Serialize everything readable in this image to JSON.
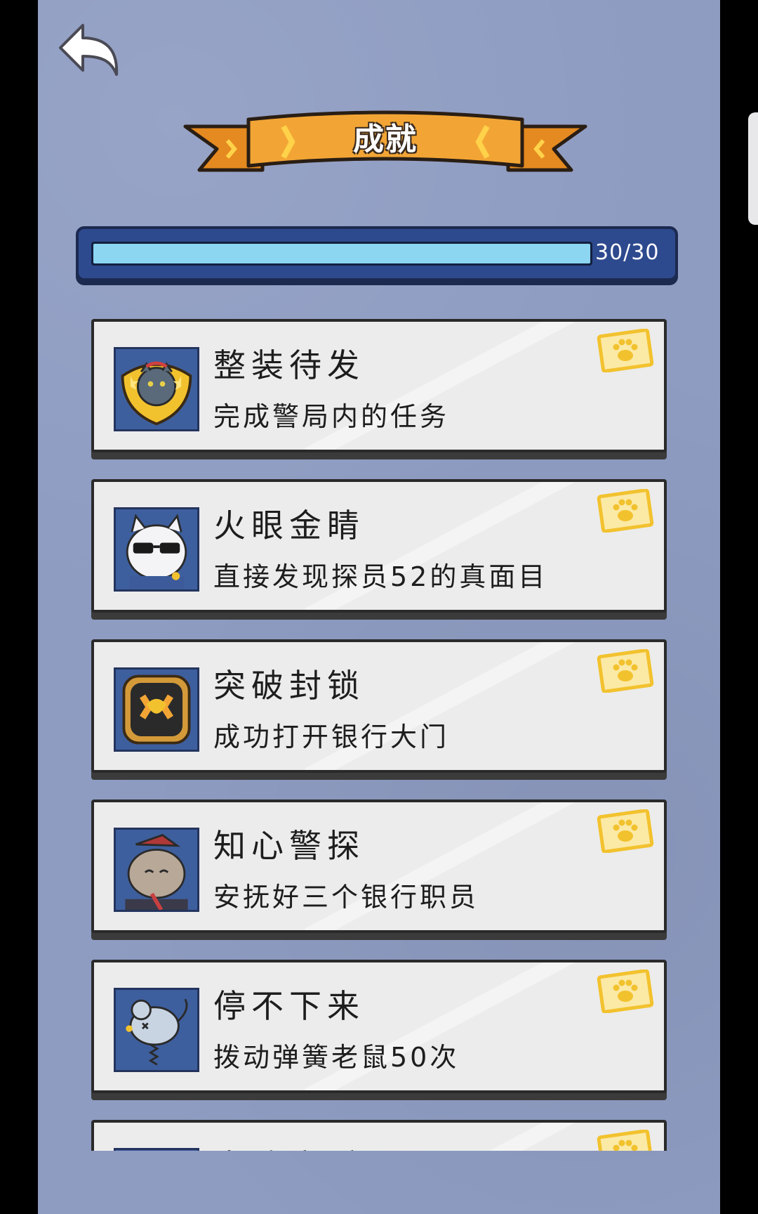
{
  "header": {
    "title": "成就",
    "back_icon": "back-arrow-icon"
  },
  "progress": {
    "label": "30/30",
    "value": 30,
    "max": 30,
    "fraction": 1.0,
    "colors": {
      "fill": "#8cd6f2",
      "frame": "#2e4a8e"
    }
  },
  "achievements": [
    {
      "title": "整装待发",
      "description": "完成警局内的任务",
      "icon": "police-badge-cat-icon",
      "stamp_icon": "paw-stamp-icon"
    },
    {
      "title": "火眼金睛",
      "description": "直接发现探员52的真面目",
      "icon": "sunglasses-cat-icon",
      "stamp_icon": "paw-stamp-icon"
    },
    {
      "title": "突破封锁",
      "description": "成功打开银行大门",
      "icon": "vault-lock-icon",
      "stamp_icon": "paw-stamp-icon"
    },
    {
      "title": "知心警探",
      "description": "安抚好三个银行职员",
      "icon": "bank-clerk-cat-icon",
      "stamp_icon": "paw-stamp-icon"
    },
    {
      "title": "停不下来",
      "description": "拨动弹簧老鼠50次",
      "icon": "spring-mouse-icon",
      "stamp_icon": "paw-stamp-icon"
    },
    {
      "title": "电路高手",
      "description": "",
      "icon": "circuit-icon",
      "stamp_icon": "paw-stamp-icon"
    }
  ],
  "colors": {
    "background": "#8e9cc2",
    "banner": "#f0a030",
    "stamp": "#f2c22e"
  }
}
